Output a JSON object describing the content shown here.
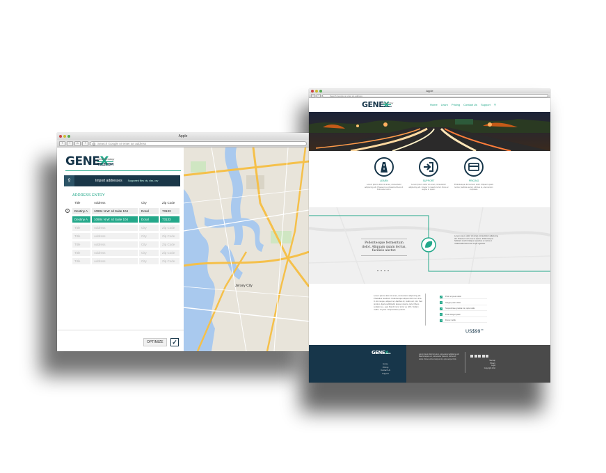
{
  "left_window": {
    "title": "Apple",
    "url_placeholder": "Search Google or enter an address",
    "logo": {
      "main_a": "GENE",
      "main_x": "X",
      "sub": "Genex Technology",
      "telecom": "TELECOM"
    },
    "import": {
      "label": "Import addresses",
      "note": "Supported files xls, xlsx, csv"
    },
    "address_entry": {
      "heading": "ADDRESS ENTRY",
      "columns": [
        "Title",
        "Address",
        "City",
        "Zip Code"
      ],
      "rows": [
        {
          "title": "Destiny A",
          "address": "10904 N.W. rd Suite 104",
          "city": "Doral",
          "zip": "73133",
          "state": "filled"
        },
        {
          "title": "Destiny A",
          "address": "10904 N.W. rd Suite 104",
          "city": "Doral",
          "zip": "73133",
          "state": "selected"
        },
        {
          "title": "Title",
          "address": "Address",
          "city": "City",
          "zip": "Zip Code",
          "state": "empty"
        },
        {
          "title": "Title",
          "address": "Address",
          "city": "City",
          "zip": "Zip Code",
          "state": "empty"
        },
        {
          "title": "Title",
          "address": "Address",
          "city": "City",
          "zip": "Zip Code",
          "state": "empty"
        },
        {
          "title": "Title",
          "address": "Address",
          "city": "City",
          "zip": "Zip Code",
          "state": "empty"
        },
        {
          "title": "Title",
          "address": "Address",
          "city": "City",
          "zip": "Zip Code",
          "state": "empty"
        }
      ]
    },
    "optimize_label": "OPTIMIZE",
    "map": {
      "label": "Jersey City"
    }
  },
  "right_window": {
    "title": "Apple",
    "url_placeholder": "Search Google or enter an address",
    "logo": {
      "main_a": "GENE",
      "main_x": "X",
      "sub": "Genex Technology",
      "telecom": "TELECOM"
    },
    "nav": [
      "Home",
      "Learn",
      "Pricing",
      "Contact Us",
      "Support"
    ],
    "features": [
      {
        "label": "LEARN",
        "text": "Lorem ipsum dolor sit amet, consectetur adipiscing elit. Praesent eu pharetra libero id. Duis aute lorem."
      },
      {
        "label": "SUPPORT",
        "text": "Lorem ipsum dolor sit amet, consectetur adipiscing elit. Integer in mauris tortor. Duis ac augue in quam."
      },
      {
        "label": "PRICING",
        "text": "Pellentesque fermentum dolor. Aliquam quam lectus, facilisis auctor, ultrices ut, elementum vulputate."
      }
    ],
    "quote": "Pellentesque fermentum dolor. Aliquam quam lectus, facilisis auctor.",
    "map_text": "Lorem ipsum dolor sit amet, consectetur adipiscing elit. Praesent vel eros ut metus. Pellentesque habitant morbi tristique senectus et netus et malesuada fames ac turpis egestas.",
    "pricing_text": "Lorem ipsum dolor sit amet, consectetur adipiscing elit. Phasellus hendrerit. Pellentesque aliquet nibh nec urna. In nisi neque, aliquet vel, dapibus id, mattis vel, nisi. Sed pretium, ligula sollicitudin laoreet viverra, tortor libero sodales leo, eget blandit nunc tortor eu nibh. Nullam mollis. Ut justo. Suspendisse potenti.",
    "checklist": [
      "Proin ut ipsum dolor",
      "Integer ipsum dolor",
      "Suspendisse gravida nisi, quis mattis",
      "Pede integer quam",
      "Donec mollis"
    ],
    "price": {
      "main": "US$99",
      "cents": ".99"
    },
    "footer": {
      "links": [
        "Home",
        "Pricing",
        "Contact Us",
        "Support"
      ],
      "text": "Lorem ipsum dolor sit amet, consectetur adipiscing elit. Mauris sapien est, consectetur placerat, ultrices id, lectus. Donec varius tempus nisi, quis semper felis.",
      "right_lines": [
        "Sitemap",
        "Privacy",
        "Legal",
        "Copyright 2014"
      ]
    }
  }
}
